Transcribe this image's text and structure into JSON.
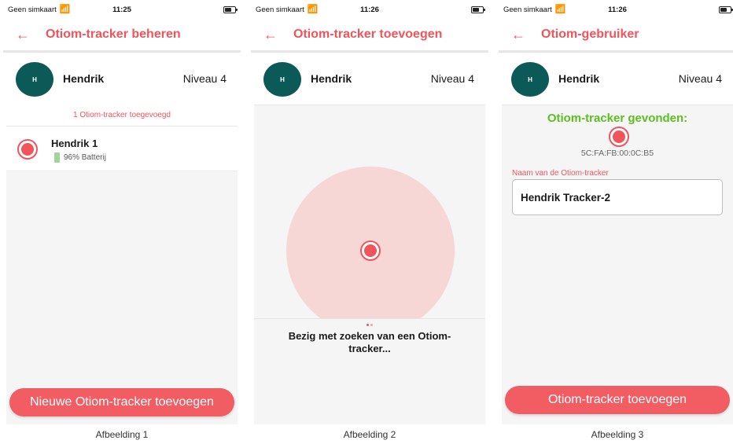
{
  "screens": [
    {
      "status": {
        "carrier": "Geen simkaart",
        "time": "11:25"
      },
      "title": "Otiom-tracker beheren",
      "user": {
        "initial": "H",
        "name": "Hendrik",
        "level": "Niveau 4"
      },
      "count_note": "1 Otiom-tracker toegevoegd",
      "tracker": {
        "name": "Hendrik 1",
        "battery": "96% Batterij"
      },
      "button": "Nieuwe Otiom-tracker toevoegen",
      "caption": "Afbeelding 1"
    },
    {
      "status": {
        "carrier": "Geen simkaart",
        "time": "11:26"
      },
      "title": "Otiom-tracker toevoegen",
      "user": {
        "initial": "H",
        "name": "Hendrik",
        "level": "Niveau 4"
      },
      "search_text": "Bezig met zoeken van een Otiom-tracker...",
      "caption": "Afbeelding 2"
    },
    {
      "status": {
        "carrier": "Geen simkaart",
        "time": "11:26"
      },
      "title": "Otiom-gebruiker",
      "user": {
        "initial": "H",
        "name": "Hendrik",
        "level": "Niveau 4"
      },
      "found_title": "Otiom-tracker gevonden:",
      "mac": "5C:FA:FB:00:0C:B5",
      "field_label": "Naam van de Otiom-tracker",
      "field_value": "Hendrik Tracker-2",
      "button": "Otiom-tracker toevoegen",
      "caption": "Afbeelding 3"
    }
  ],
  "icons": {
    "back": "arrow-left-icon",
    "wifi": "wifi-icon",
    "battery": "battery-icon",
    "tracker": "tracker-dot-icon"
  },
  "colors": {
    "accent": "#f2545b",
    "avatar": "#0b5a57",
    "found": "#5bbf1e",
    "radar": "#f7d6d6",
    "battery_ok": "#9fd49a"
  }
}
